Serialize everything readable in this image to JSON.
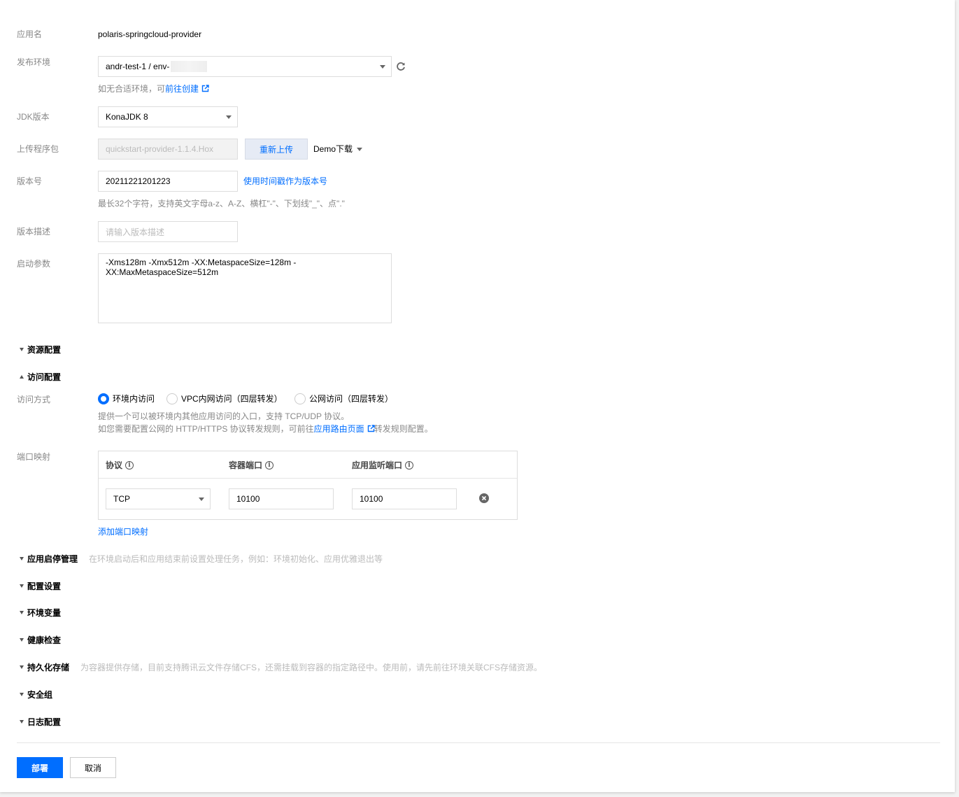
{
  "form": {
    "app_name_label": "应用名",
    "app_name_value": "polaris-springcloud-provider",
    "env_label": "发布环境",
    "env_value": "andr-test-1 / env-",
    "env_hint_prefix": "如无合适环境，可",
    "env_hint_link": "前往创建",
    "jdk_label": "JDK版本",
    "jdk_value": "KonaJDK 8",
    "upload_label": "上传程序包",
    "upload_value": "quickstart-provider-1.1.4.Hox",
    "reupload_button": "重新上传",
    "demo_download": "Demo下载",
    "version_label": "版本号",
    "version_value": "20211221201223",
    "version_link": "使用时间戳作为版本号",
    "version_hint": "最长32个字符，支持英文字母a-z、A-Z、横杠\"-\"、下划线\"_\"、点\".\"",
    "version_desc_label": "版本描述",
    "version_desc_placeholder": "请输入版本描述",
    "start_params_label": "启动参数",
    "start_params_value": "-Xms128m -Xmx512m -XX:MetaspaceSize=128m -\nXX:MaxMetaspaceSize=512m"
  },
  "sections": {
    "resource": "资源配置",
    "access": "访问配置",
    "lifecycle": "应用启停管理",
    "lifecycle_desc": "在环境启动后和应用结束前设置处理任务，例如：环境初始化、应用优雅退出等",
    "config": "配置设置",
    "env_vars": "环境变量",
    "health": "健康检查",
    "storage": "持久化存储",
    "storage_desc": "为容器提供存储，目前支持腾讯云文件存储CFS，还需挂载到容器的指定路径中。使用前，请先前往环境关联CFS存储资源。",
    "security": "安全组",
    "log": "日志配置"
  },
  "access": {
    "mode_label": "访问方式",
    "options": [
      "环境内访问",
      "VPC内网访问（四层转发）",
      "公网访问（四层转发）"
    ],
    "hint1": "提供一个可以被环境内其他应用访问的入口，支持 TCP/UDP 协议。",
    "hint2_prefix": "如您需要配置公网的 HTTP/HTTPS 协议转发规则，可前往",
    "hint2_link": "应用路由页面",
    "hint2_suffix": "转发规则配置。",
    "port_label": "端口映射",
    "columns": [
      "协议",
      "容器端口",
      "应用监听端口"
    ],
    "row": {
      "protocol": "TCP",
      "container_port": "10100",
      "listen_port": "10100"
    },
    "add_link": "添加端口映射"
  },
  "footer": {
    "deploy": "部署",
    "cancel": "取消"
  },
  "colors": {
    "accent": "#006eff"
  }
}
